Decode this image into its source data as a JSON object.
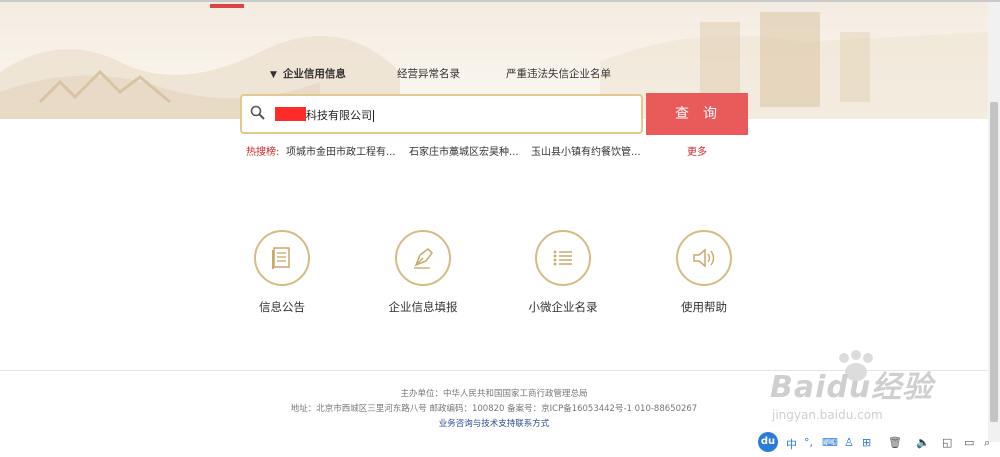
{
  "tabs": [
    {
      "label": "企业信用信息",
      "active": true
    },
    {
      "label": "经营异常名录",
      "active": false
    },
    {
      "label": "严重违法失信企业名单",
      "active": false
    }
  ],
  "search": {
    "value": "科技有限公司",
    "button_label": "查询"
  },
  "hot_search": {
    "label": "热搜榜:",
    "items": [
      "项城市金田市政工程有...",
      "石家庄市藁城区宏昊种...",
      "玉山县小镇有约餐饮管..."
    ],
    "more": "更多"
  },
  "features": [
    {
      "label": "信息公告",
      "icon": "document-icon"
    },
    {
      "label": "企业信息填报",
      "icon": "pen-icon"
    },
    {
      "label": "小微企业名录",
      "icon": "list-icon"
    },
    {
      "label": "使用帮助",
      "icon": "speaker-icon"
    }
  ],
  "footer": {
    "sponsor": "主办单位：中华人民共和国国家工商行政管理总局",
    "address": "地址：北京市西城区三里河东路八号    邮政编码：100820    备案号：京ICP备16053442号-1    010-88650267",
    "contact": "业务咨询与技术支持联系方式"
  },
  "watermark": {
    "brand": "Baidu经验",
    "url": "jingyan.baidu.com"
  },
  "ime": {
    "badge": "du",
    "lang": "中"
  },
  "colors": {
    "accent_gold": "#d7bb86",
    "search_button": "#e95a5a",
    "hot_red": "#cc2a2a",
    "link_blue": "#2a4d8f"
  }
}
